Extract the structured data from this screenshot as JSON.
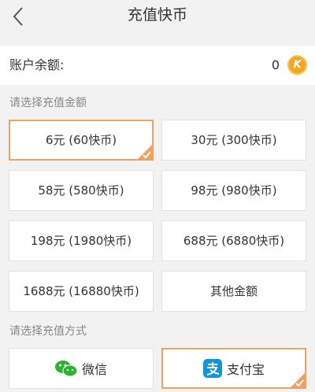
{
  "header": {
    "title": "充值快币"
  },
  "balance": {
    "label": "账户余额:",
    "value": "0",
    "coin_letter": "K"
  },
  "amount_section": {
    "label": "请选择充值金额"
  },
  "amounts": [
    {
      "label": "6元 (60快币)",
      "selected": true
    },
    {
      "label": "30元 (300快币)",
      "selected": false
    },
    {
      "label": "58元 (580快币)",
      "selected": false
    },
    {
      "label": "98元 (980快币)",
      "selected": false
    },
    {
      "label": "198元 (1980快币)",
      "selected": false
    },
    {
      "label": "688元 (6880快币)",
      "selected": false
    },
    {
      "label": "1688元 (16880快币)",
      "selected": false
    },
    {
      "label": "其他金额",
      "selected": false
    }
  ],
  "payment_section": {
    "label": "请选择充值方式"
  },
  "payments": [
    {
      "label": "微信",
      "icon": "wechat-icon",
      "selected": false
    },
    {
      "label": "支付宝",
      "icon": "alipay-icon",
      "selected": true
    }
  ],
  "colors": {
    "accent": "#f0a060",
    "coin": "#f5a623",
    "wechat": "#2bb32e",
    "alipay": "#1296db"
  }
}
